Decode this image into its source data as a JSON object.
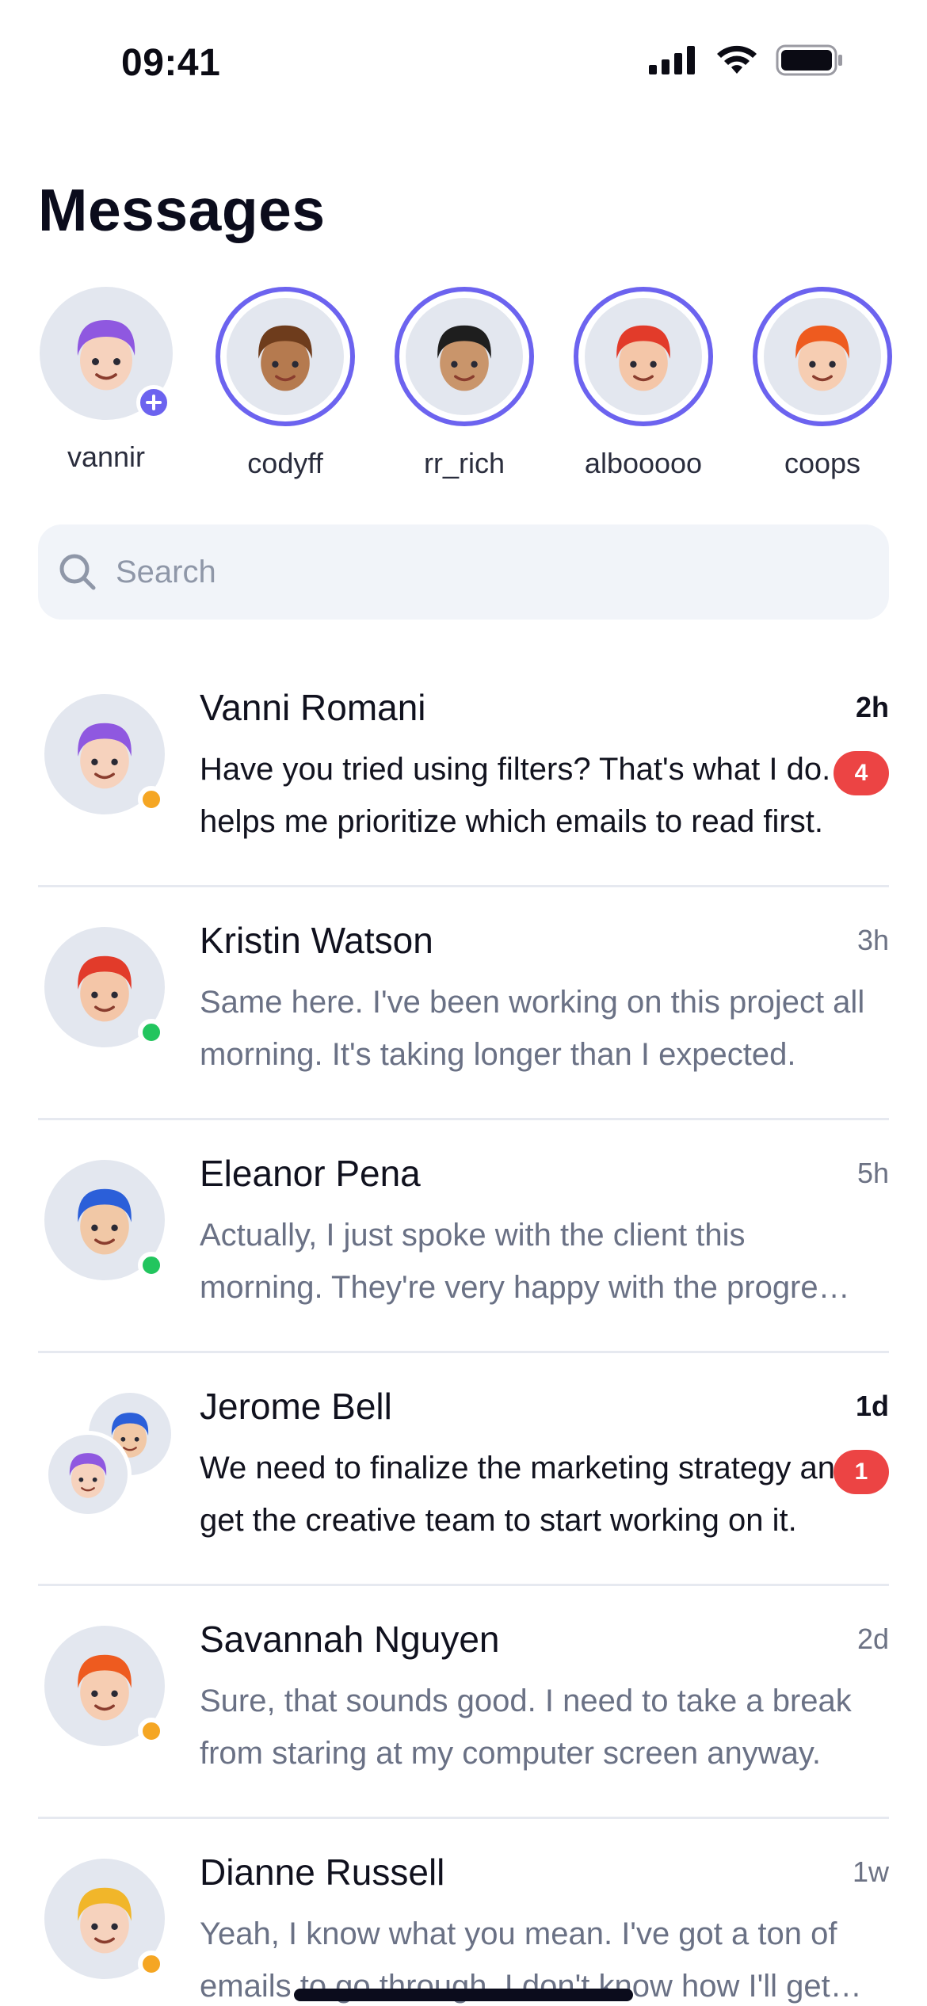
{
  "status_bar": {
    "time": "09:41",
    "icons": [
      "signal-icon",
      "wifi-icon",
      "battery-icon"
    ]
  },
  "header": {
    "title": "Messages"
  },
  "stories": [
    {
      "name": "vannir",
      "hair": "#8f58e0",
      "skin": "#f6d2bd",
      "own": true
    },
    {
      "name": "codyff",
      "hair": "#6e3c1c",
      "skin": "#b57a4f",
      "own": false
    },
    {
      "name": "rr_rich",
      "hair": "#1e1e1e",
      "skin": "#c9956b",
      "own": false
    },
    {
      "name": "albooooo",
      "hair": "#e23b2a",
      "skin": "#f4c6a8",
      "own": false
    },
    {
      "name": "coops",
      "hair": "#ee5b1f",
      "skin": "#f6cdb2",
      "own": false
    }
  ],
  "search": {
    "placeholder": "Search"
  },
  "conversations": [
    {
      "name": "Vanni Romani",
      "time": "2h",
      "message": "Have you tried using filters? That's what I do. It helps me prioritize which emails to read first.",
      "unread": true,
      "badge": "4",
      "presence": "#f5a623",
      "hair": "#8f58e0",
      "skin": "#f6d2bd"
    },
    {
      "name": "Kristin Watson",
      "time": "3h",
      "message": "Same here. I've been working on this project all morning. It's taking longer than I expected.",
      "unread": false,
      "badge": "",
      "presence": "#22c55e",
      "hair": "#e23b2a",
      "skin": "#f4c6a8"
    },
    {
      "name": "Eleanor Pena",
      "time": "5h",
      "message": "Actually, I just spoke with the client this morning. They're very happy with the progress so far.",
      "unread": false,
      "badge": "",
      "presence": "#22c55e",
      "hair": "#2b5fd9",
      "skin": "#f1c8a6"
    },
    {
      "name": "Jerome Bell",
      "time": "1d",
      "message": "We need to finalize the marketing strategy and get the creative team to start working on it.",
      "unread": true,
      "badge": "1",
      "presence": "",
      "hair": "#2b5fd9",
      "skin": "#f1c8a6",
      "hair2": "#8f58e0",
      "skin2": "#f6d2bd"
    },
    {
      "name": "Savannah Nguyen",
      "time": "2d",
      "message": "Sure, that sounds good. I need to take a break from staring at my computer screen anyway.",
      "unread": false,
      "badge": "",
      "presence": "#f5a623",
      "hair": "#ee5b1f",
      "skin": "#f6cdb2"
    },
    {
      "name": "Dianne Russell",
      "time": "1w",
      "message": "Yeah, I know what you mean. I've got a ton of emails to go through. I don't know how I'll get through them all.",
      "unread": false,
      "badge": "",
      "presence": "#f5a623",
      "hair": "#f1b62a",
      "skin": "#f6d2bd"
    }
  ]
}
